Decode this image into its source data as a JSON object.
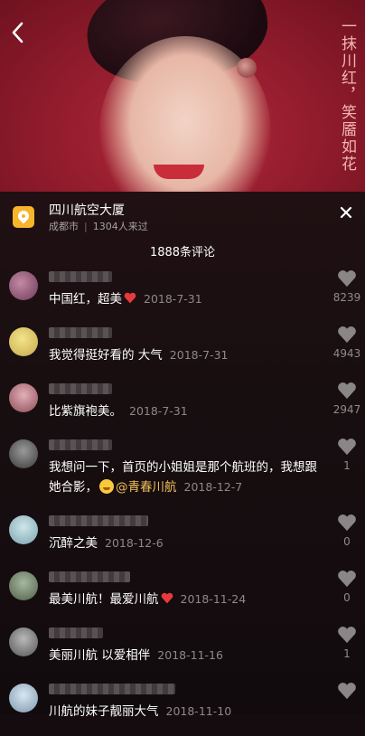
{
  "video": {
    "slogan": "一抹川红，笑靥如花"
  },
  "location": {
    "name": "四川航空大厦",
    "city": "成都市",
    "visitors": "1304人来过"
  },
  "comments_count": "1888条评论",
  "comments": [
    {
      "text": "中国红，超美",
      "emoji": "red-heart",
      "date": "2018-7-31",
      "likes": "8239"
    },
    {
      "text": "我觉得挺好看的 大气",
      "date": "2018-7-31",
      "likes": "4943"
    },
    {
      "text": "比紫旗袍美。",
      "date": "2018-7-31",
      "likes": "2947"
    },
    {
      "text": "我想问一下，首页的小姐姐是那个航班的，我想跟她合影，",
      "emoji": "smiling-face",
      "mention": "@青春川航",
      "date": "2018-12-7",
      "likes": "1"
    },
    {
      "text": "沉醉之美",
      "date": "2018-12-6",
      "likes": "0"
    },
    {
      "text": "最美川航！最爱川航",
      "emoji": "red-heart",
      "date": "2018-11-24",
      "likes": "0"
    },
    {
      "text": "美丽川航 以爱相伴",
      "date": "2018-11-16",
      "likes": "1"
    },
    {
      "text": "川航的妹子靓丽大气",
      "date": "2018-11-10",
      "likes": ""
    }
  ],
  "colors": {
    "accent_mention": "#f4c25b",
    "location_icon": "#f6b52a"
  }
}
